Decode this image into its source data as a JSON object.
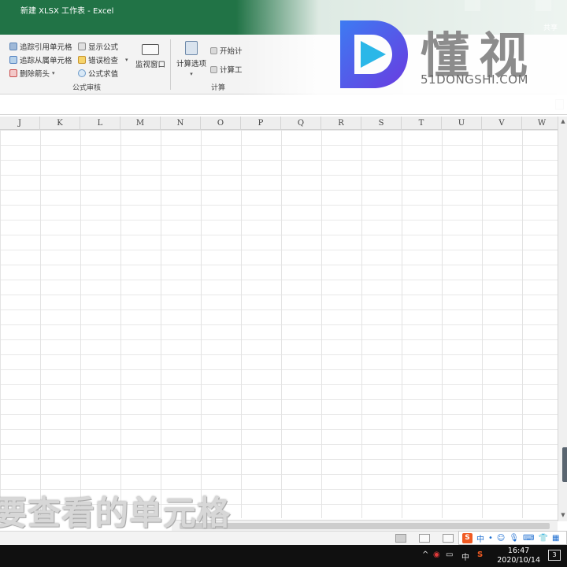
{
  "window": {
    "title": "新建 XLSX 工作表  -  Excel",
    "share_label": "共享"
  },
  "ribbon": {
    "formula_auditing": {
      "trace_precedents": "追踪引用单元格",
      "trace_dependents": "追踪从属单元格",
      "remove_arrows": "删除箭头",
      "show_formulas": "显示公式",
      "error_checking": "错误检查",
      "evaluate_formula": "公式求值",
      "watch_window": "监视窗口",
      "group_label": "公式审核"
    },
    "calculation": {
      "calc_options": "计算选项",
      "calc_now": "开始计",
      "calc_sheet": "计算工",
      "group_label": "计算"
    }
  },
  "watermark": {
    "brand_cn": "懂视",
    "brand_en": "51DONGSHI.COM"
  },
  "sheet": {
    "columns": [
      "J",
      "K",
      "L",
      "M",
      "N",
      "O",
      "P",
      "Q",
      "R",
      "S",
      "T",
      "U",
      "V",
      "W"
    ]
  },
  "subtitle": "要查看的单元格",
  "taskbar": {
    "ime_lang": "中",
    "tray_lang": "中",
    "time": "16:47",
    "date": "2020/10/14",
    "notification_count": "3"
  },
  "colors": {
    "excel_green": "#217346",
    "ribbon_bg": "#f3f3f3",
    "taskbar_bg": "#101010"
  }
}
